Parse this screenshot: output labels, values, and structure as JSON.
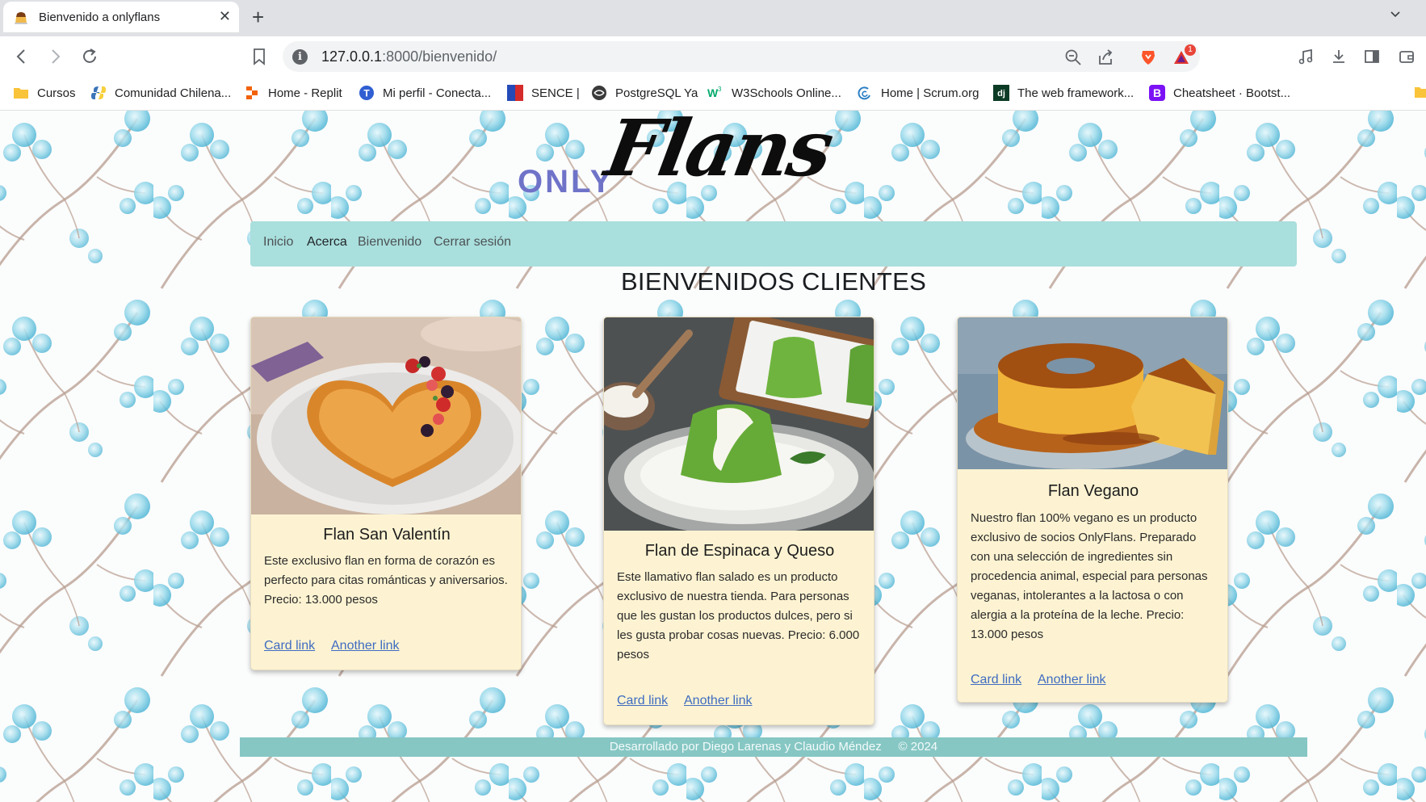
{
  "browser": {
    "tab_title": "Bienvenido a onlyflans",
    "url_host": "127.0.0.1",
    "url_path": ":8000/bienvenido/",
    "extension_badge": "1",
    "bookmarks": [
      {
        "label": "Cursos",
        "icon": "folder-icon"
      },
      {
        "label": "Comunidad Chilena...",
        "icon": "python-icon"
      },
      {
        "label": "Home - Replit",
        "icon": "replit-icon"
      },
      {
        "label": "Mi perfil - Conecta...",
        "icon": "conecta-icon"
      },
      {
        "label": "SENCE |",
        "icon": "sence-icon"
      },
      {
        "label": "PostgreSQL Ya",
        "icon": "postgres-icon"
      },
      {
        "label": "W3Schools Online...",
        "icon": "w3schools-icon"
      },
      {
        "label": "Home | Scrum.org",
        "icon": "scrum-icon"
      },
      {
        "label": "The web framework...",
        "icon": "django-icon"
      },
      {
        "label": "Cheatsheet · Bootst...",
        "icon": "bootstrap-icon"
      }
    ]
  },
  "site": {
    "logo_prefix": "ONLY",
    "logo_main": "Flans",
    "nav": [
      {
        "label": "Inicio"
      },
      {
        "label": "Acerca"
      },
      {
        "label": "Bienvenido"
      },
      {
        "label": "Cerrar sesión"
      }
    ],
    "heading": "BIENVENIDOS CLIENTES",
    "cards": [
      {
        "title": "Flan San Valentín",
        "text": "Este exclusivo flan en forma de corazón es perfecto para citas románticas y aniversarios. Precio: 13.000 pesos",
        "link1": "Card link",
        "link2": "Another link"
      },
      {
        "title": "Flan de Espinaca y Queso",
        "text": "Este llamativo flan salado es un producto exclusivo de nuestra tienda. Para personas que les gustan los productos dulces, pero si les gusta probar cosas nuevas. Precio: 6.000 pesos",
        "link1": "Card link",
        "link2": "Another link"
      },
      {
        "title": "Flan Vegano",
        "text": "Nuestro flan 100% vegano es un producto exclusivo de socios OnlyFlans. Preparado con una selección de ingredientes sin procedencia animal, especial para personas veganas, intolerantes a la lactosa o con alergia a la proteína de la leche. Precio: 13.000 pesos",
        "link1": "Card link",
        "link2": "Another link"
      }
    ],
    "footer_credit": "Desarrollado por Diego Larenas y Claudio Méndez",
    "footer_year": "© 2024"
  },
  "colors": {
    "navbar": "#a9dfdd",
    "card_bg": "#fdf3d2",
    "footer": "#86c7c4",
    "link": "#3f6cc1",
    "logo_prefix": "#6f73c8"
  }
}
